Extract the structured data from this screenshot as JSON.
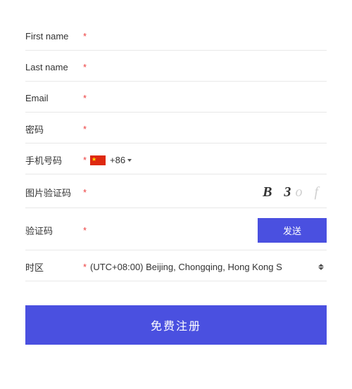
{
  "form": {
    "first_name": {
      "label": "First name",
      "required": "*"
    },
    "last_name": {
      "label": "Last name",
      "required": "*"
    },
    "email": {
      "label": "Email",
      "required": "*"
    },
    "password": {
      "label": "密码",
      "required": "*"
    },
    "phone": {
      "label": "手机号码",
      "required": "*",
      "dial_code": "+86"
    },
    "captcha": {
      "label": "图片验证码",
      "required": "*",
      "image_text_1": "B 3",
      "image_text_2": "o  f"
    },
    "sms": {
      "label": "验证码",
      "required": "*",
      "send_label": "发送"
    },
    "timezone": {
      "label": "时区",
      "required": "*",
      "value": "(UTC+08:00) Beijing, Chongqing, Hong Kong S"
    },
    "submit_label": "免费注册"
  },
  "colors": {
    "accent": "#4a50e0",
    "required": "#ec3e3e"
  }
}
